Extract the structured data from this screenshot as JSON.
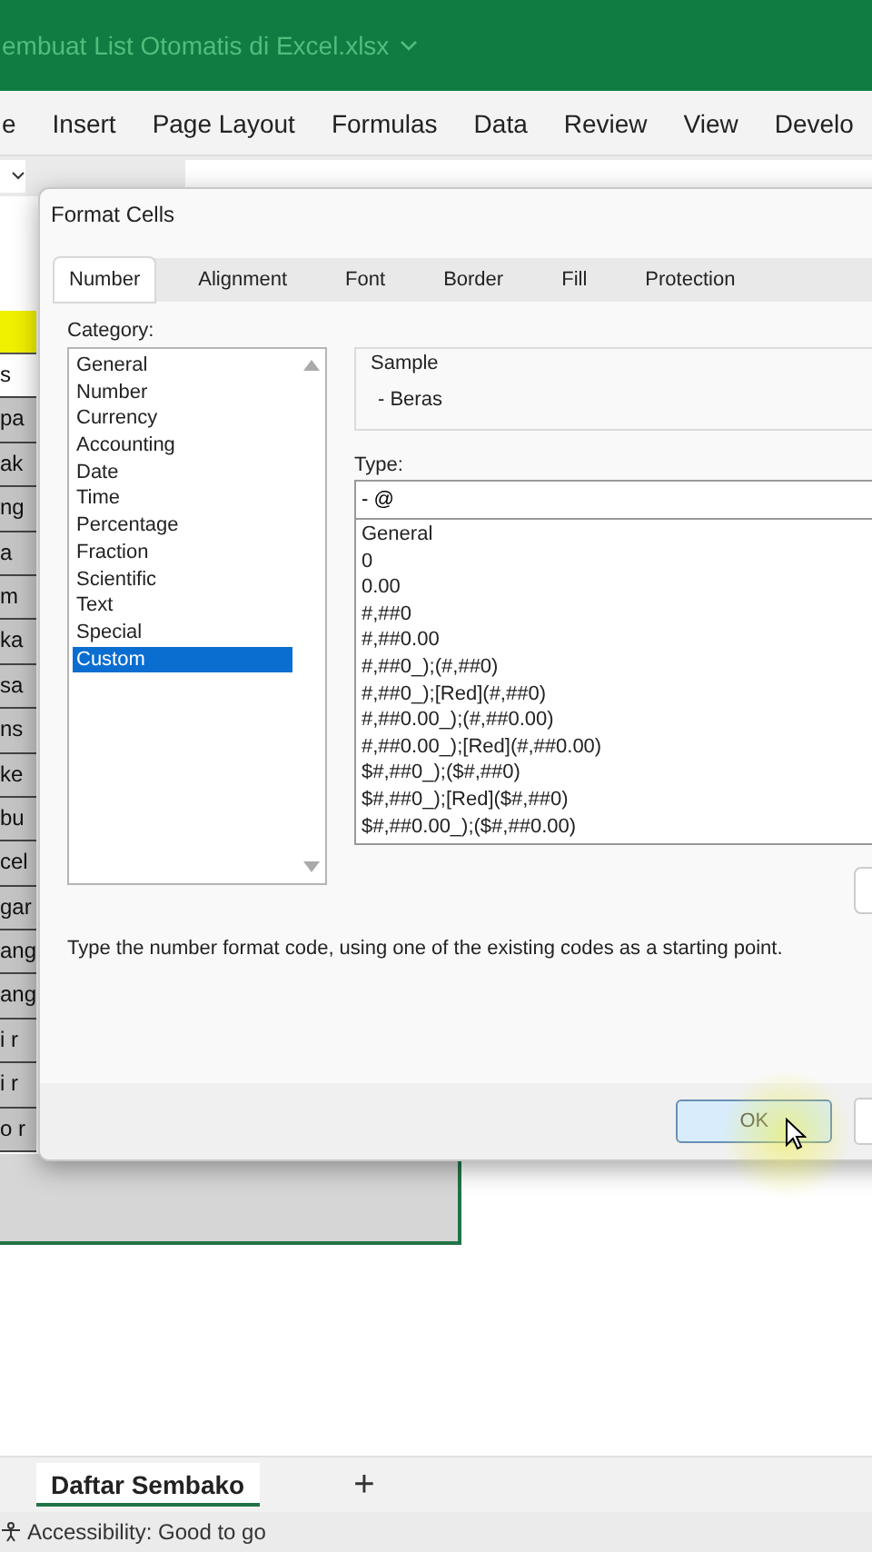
{
  "title_bar": {
    "filename": "embuat List Otomatis di Excel.xlsx"
  },
  "ribbon_tabs": [
    {
      "label": "e"
    },
    {
      "label": "Insert"
    },
    {
      "label": "Page Layout"
    },
    {
      "label": "Formulas"
    },
    {
      "label": "Data"
    },
    {
      "label": "Review"
    },
    {
      "label": "View"
    },
    {
      "label": "Develo"
    }
  ],
  "sheet_cells": [
    "s",
    "pa",
    "ak",
    "ng",
    "a",
    "m",
    "ka",
    "sa",
    "ns",
    "ke",
    "bu",
    "cel",
    "gar",
    "ang",
    "ang",
    "i r",
    "i r",
    "o r"
  ],
  "dialog": {
    "title": "Format Cells",
    "tabs": [
      {
        "label": "Number",
        "selected": true
      },
      {
        "label": "Alignment",
        "selected": false
      },
      {
        "label": "Font",
        "selected": false
      },
      {
        "label": "Border",
        "selected": false
      },
      {
        "label": "Fill",
        "selected": false
      },
      {
        "label": "Protection",
        "selected": false
      }
    ],
    "category_label": "Category:",
    "categories": [
      {
        "label": "General",
        "selected": false
      },
      {
        "label": "Number",
        "selected": false
      },
      {
        "label": "Currency",
        "selected": false
      },
      {
        "label": "Accounting",
        "selected": false
      },
      {
        "label": "Date",
        "selected": false
      },
      {
        "label": "Time",
        "selected": false
      },
      {
        "label": "Percentage",
        "selected": false
      },
      {
        "label": "Fraction",
        "selected": false
      },
      {
        "label": "Scientific",
        "selected": false
      },
      {
        "label": "Text",
        "selected": false
      },
      {
        "label": "Special",
        "selected": false
      },
      {
        "label": "Custom",
        "selected": true
      }
    ],
    "sample": {
      "label": "Sample",
      "value": "- Beras"
    },
    "type": {
      "label": "Type:",
      "value": "- @"
    },
    "type_list": [
      "General",
      "0",
      "0.00",
      "#,##0",
      "#,##0.00",
      "#,##0_);(#,##0)",
      "#,##0_);[Red](#,##0)",
      "#,##0.00_);(#,##0.00)",
      "#,##0.00_);[Red](#,##0.00)",
      "$#,##0_);($#,##0)",
      "$#,##0_);[Red]($#,##0)",
      "$#,##0.00_);($#,##0.00)"
    ],
    "description": "Type the number format code, using one of the existing codes as a starting point.",
    "ok_button": "OK"
  },
  "sheet_tabs": [
    {
      "label": "Daftar Sembako",
      "selected": true
    }
  ],
  "add_sheet": "+",
  "status_bar": {
    "accessibility": "Accessibility: Good to go"
  }
}
